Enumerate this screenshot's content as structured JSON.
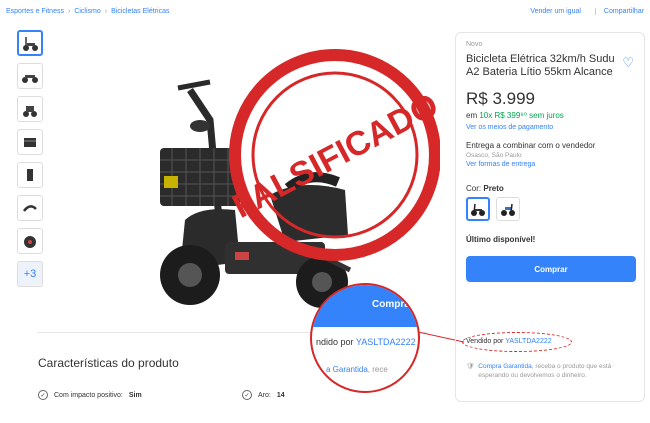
{
  "breadcrumb": {
    "items": [
      "Esportes e Fitness",
      "Ciclismo",
      "Bicicletas Elétricas"
    ],
    "right": [
      "Vender um igual",
      "Compartilhar"
    ]
  },
  "thumbnails": {
    "more_label": "+3"
  },
  "stamp": {
    "text": "FALSIFICADO",
    "color": "#d62828"
  },
  "product": {
    "condition": "Novo",
    "title": "Bicicleta Elétrica 32km/h Sudu A2 Bateria Lítio 55km Alcance",
    "price": "R$ 3.999",
    "installments_prefix": "em ",
    "installments_green": "10x R$ 399⁹⁰ sem juros",
    "payment_link": "Ver os meios de pagamento",
    "shipping": "Entrega a combinar com o vendedor",
    "location": "Osasco, São Paulo",
    "shipping_link": "Ver formas de entrega",
    "color_label": "Cor:",
    "color_value": "Preto",
    "stock": "Último disponível!",
    "buy_button": "Comprar",
    "seller_prefix": "Vendido por ",
    "seller_name": "YASLTDA2222",
    "guarantee_link": "Compra Garantida",
    "guarantee_text": ", receba o produto que está esperando ou devolvemos o dinheiro."
  },
  "zoom": {
    "button": "Compra",
    "seller_prefix": "ndido por ",
    "seller_name": "YASLTDA2222",
    "guarantee_link": "a Garantida",
    "guarantee_text": ", rece"
  },
  "characteristics": {
    "title": "Características do produto",
    "items": [
      {
        "label": "Com impacto positivo: ",
        "value": "Sim"
      },
      {
        "label": "Aro: ",
        "value": "14"
      }
    ]
  },
  "colors": {
    "accent": "#3483fa",
    "green": "#00a650",
    "stamp": "#d62828"
  }
}
